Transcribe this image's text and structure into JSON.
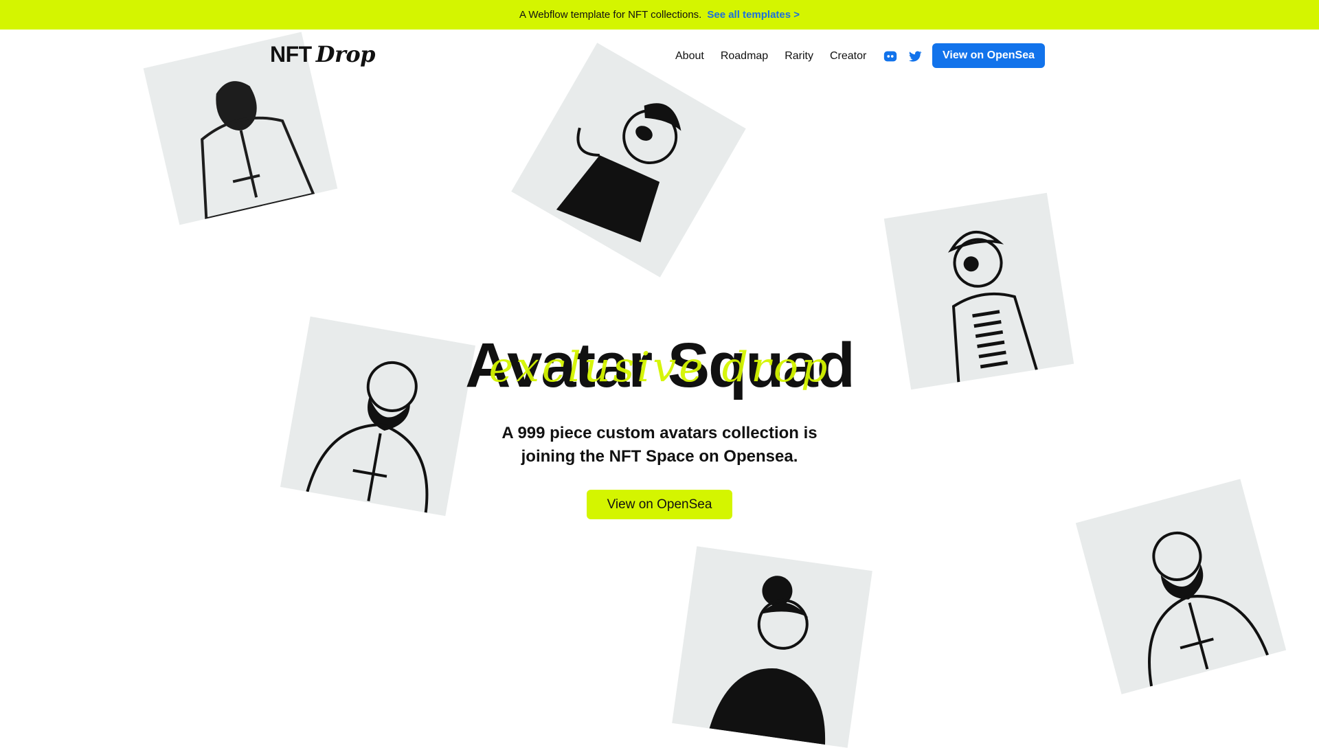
{
  "banner": {
    "text": "A Webflow template for NFT collections.",
    "link": "See all templates >"
  },
  "nav": {
    "logo_main": "NFT",
    "logo_italic": "Drop",
    "links": [
      "About",
      "Roadmap",
      "Rarity",
      "Creator"
    ],
    "icons": [
      "discord-icon",
      "twitter-icon"
    ],
    "cta": "View on OpenSea"
  },
  "hero": {
    "title": "Avatar Squad",
    "script": "exclusive drop",
    "subtitle_line1": "A 999 piece custom avatars collection is",
    "subtitle_line2": "joining the NFT Space on Opensea.",
    "cta": "View on OpenSea"
  },
  "colors": {
    "accent": "#d4f500",
    "primary_button": "#1273eb",
    "card_bg": "#e8ebeb"
  }
}
